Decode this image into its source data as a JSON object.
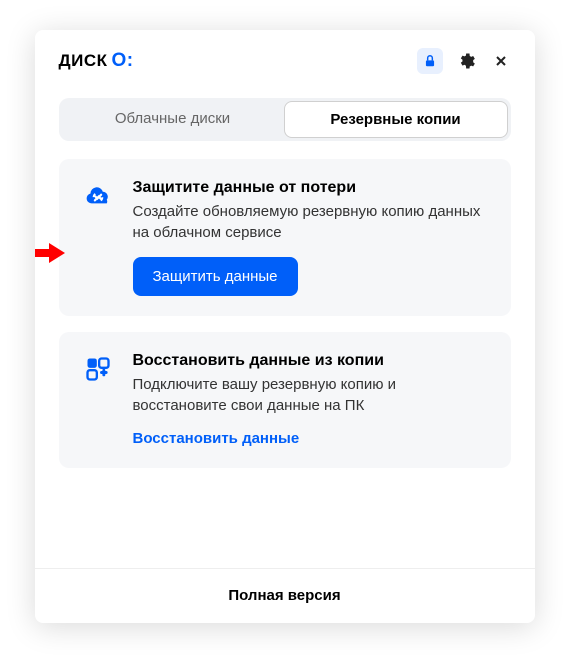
{
  "header": {
    "logo_text": "ДИСК",
    "logo_symbol": "О:"
  },
  "tabs": {
    "cloud_disks": "Облачные диски",
    "backups": "Резервные копии"
  },
  "protect_card": {
    "title": "Защитите данные от потери",
    "description": "Создайте обновляемую резервную копию данных на облачном сервисе",
    "button": "Защитить данные"
  },
  "restore_card": {
    "title": "Восстановить данные из копии",
    "description": "Подключите вашу резервную копию и восстановите свои данные на ПК",
    "link": "Восстановить данные"
  },
  "footer": {
    "full_version": "Полная версия"
  }
}
